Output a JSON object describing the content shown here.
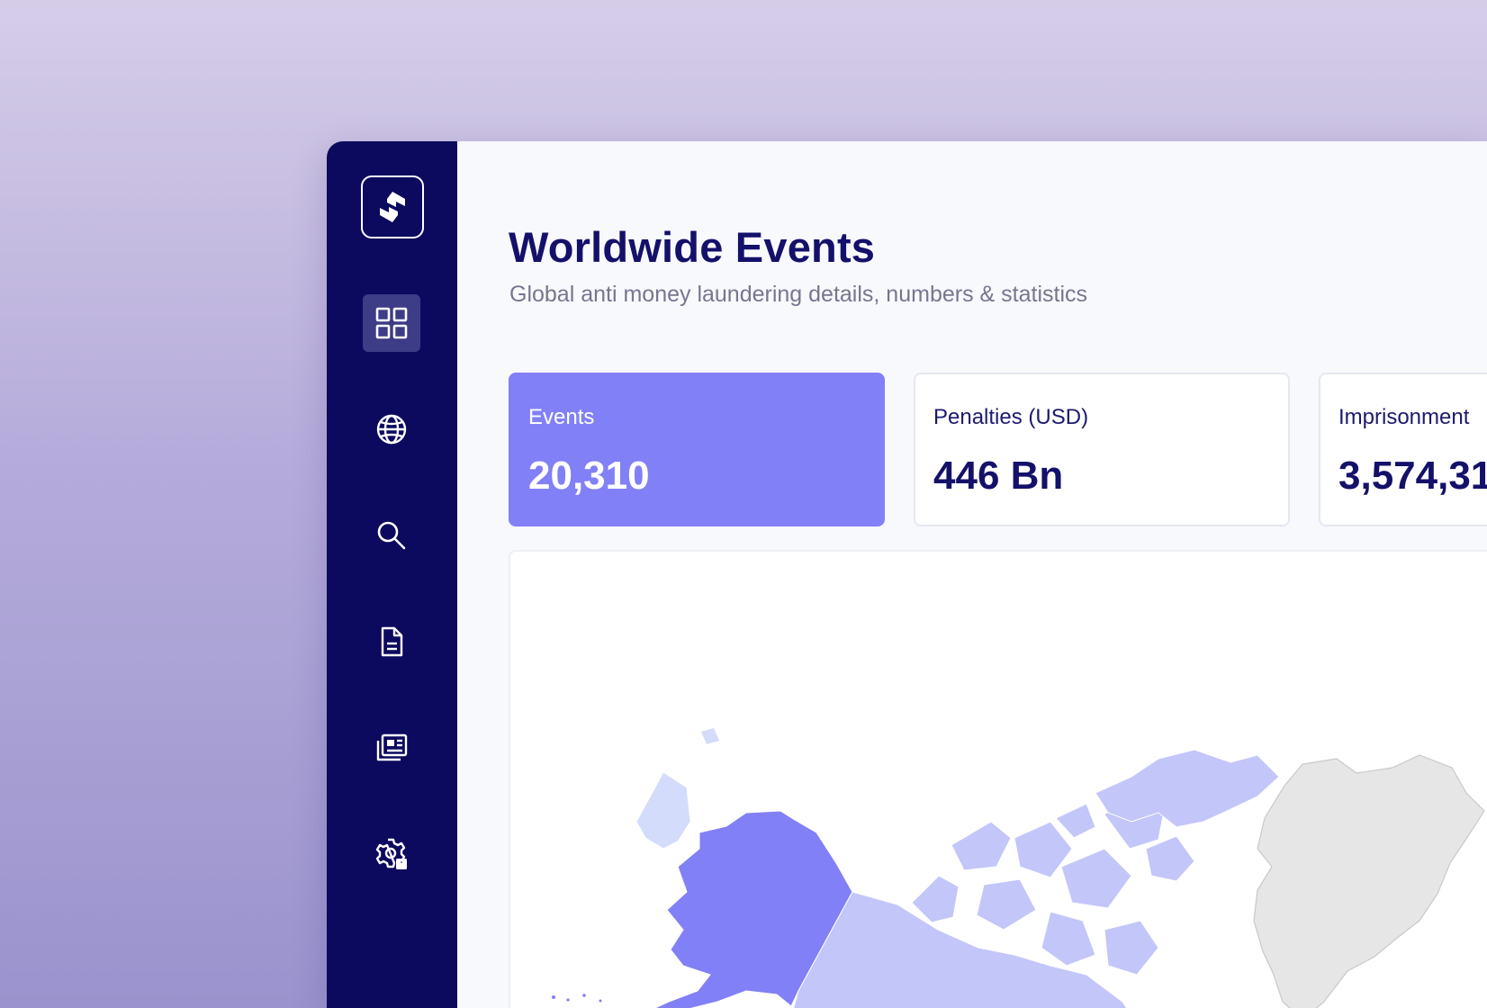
{
  "sidebar": {
    "logo": {
      "icon": "app-logo-icon"
    },
    "items": [
      {
        "name": "dashboard",
        "icon": "grid-icon",
        "active": true
      },
      {
        "name": "globe",
        "icon": "globe-icon",
        "active": false
      },
      {
        "name": "search",
        "icon": "search-icon",
        "active": false
      },
      {
        "name": "documents",
        "icon": "document-icon",
        "active": false
      },
      {
        "name": "news",
        "icon": "news-icon",
        "active": false
      },
      {
        "name": "settings",
        "icon": "gear-user-icon",
        "active": false
      }
    ]
  },
  "header": {
    "title": "Worldwide Events",
    "subtitle": "Global anti money laundering details, numbers & statistics"
  },
  "stats": [
    {
      "label": "Events",
      "value": "20,310"
    },
    {
      "label": "Penalties (USD)",
      "value": "446 Bn"
    },
    {
      "label": "Imprisonment",
      "value": "3,574,31"
    }
  ],
  "colors": {
    "sidebar_bg": "#0b0a5e",
    "accent": "#8280f6",
    "map_high": "#8280f6",
    "map_mid": "#c3c6f9",
    "map_low": "#d3dcfa",
    "map_none": "#e6e6e6"
  }
}
